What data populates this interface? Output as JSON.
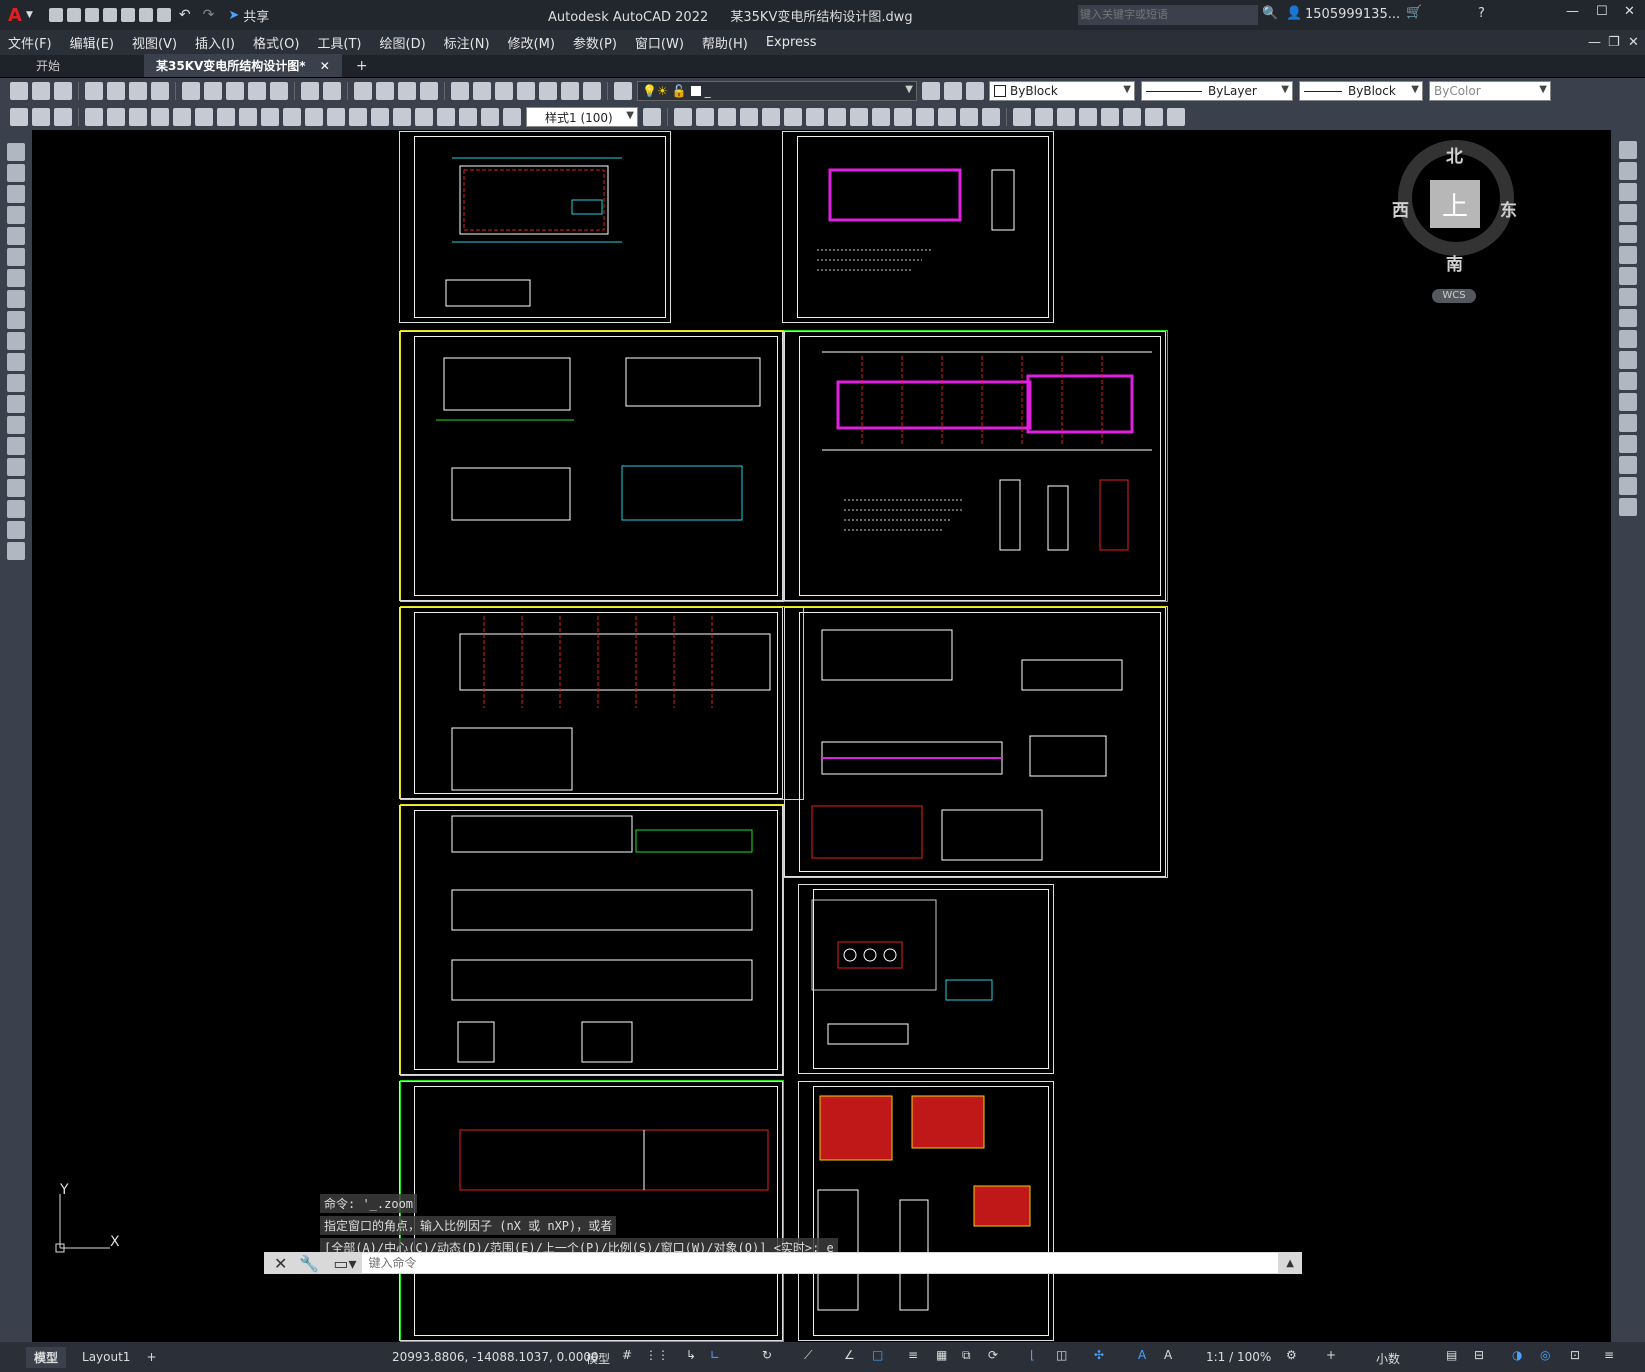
{
  "app": {
    "logo": "A",
    "title": "Autodesk AutoCAD 2022",
    "file": "某35KV变电所结构设计图.dwg",
    "share": "共享",
    "search_placeholder": "键入关键字或短语",
    "user": "1505999135...",
    "window_controls": [
      "minimize-icon",
      "maximize-icon",
      "close-icon"
    ]
  },
  "menu": [
    "文件(F)",
    "编辑(E)",
    "视图(V)",
    "插入(I)",
    "格式(O)",
    "工具(T)",
    "绘图(D)",
    "标注(N)",
    "修改(M)",
    "参数(P)",
    "窗口(W)",
    "帮助(H)",
    "Express"
  ],
  "tabs": [
    {
      "label": "开始",
      "active": false
    },
    {
      "label": "某35KV变电所结构设计图*",
      "active": true
    }
  ],
  "toolbar": {
    "layer_value": "_",
    "color": "ByBlock",
    "linetype": "ByLayer",
    "lineweight": "ByBlock",
    "plotstyle": "ByColor",
    "dimstyle": "样式1 (100)"
  },
  "viewcube": {
    "north": "北",
    "south": "南",
    "east": "东",
    "west": "西",
    "top": "上",
    "wcs": "WCS"
  },
  "ucs": {
    "y": "Y",
    "x": "X"
  },
  "command": {
    "history": [
      "命令: '_.zoom",
      "指定窗口的角点，输入比例因子 (nX 或 nXP)，或者",
      "[全部(A)/中心(C)/动态(D)/范围(E)/上一个(P)/比例(S)/窗口(W)/对象(O)] <实时>: e"
    ],
    "placeholder": "键入命令"
  },
  "status": {
    "layout_tabs": [
      "模型",
      "Layout1"
    ],
    "coords": "20993.8806, -14088.1037, 0.0000",
    "space": "模型",
    "scale": "1:1 / 100%",
    "units": "小数"
  },
  "colors": {
    "sheet_border": "#dddddd",
    "yellow_frame": "#e0e020",
    "green_frame": "#19e619",
    "drawing_red": "#e02020",
    "drawing_magenta": "#e020e0",
    "drawing_cyan": "#20d0e0"
  }
}
